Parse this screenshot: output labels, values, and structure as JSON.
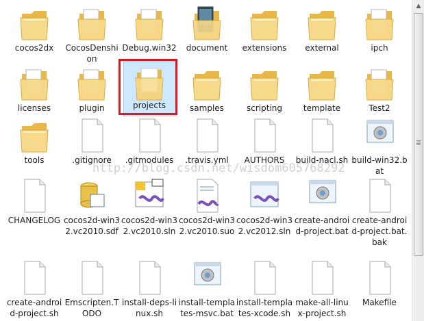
{
  "files": [
    {
      "name": "cocos2dx",
      "type": "folder"
    },
    {
      "name": "CocosDenshion",
      "type": "folder-doc"
    },
    {
      "name": "Debug.win32",
      "type": "folder-doc"
    },
    {
      "name": "document",
      "type": "folder-photo"
    },
    {
      "name": "extensions",
      "type": "folder"
    },
    {
      "name": "external",
      "type": "folder"
    },
    {
      "name": "ipch",
      "type": "folder-doc"
    },
    {
      "name": "licenses",
      "type": "folder-doc"
    },
    {
      "name": "plugin",
      "type": "folder-doc"
    },
    {
      "name": "projects",
      "type": "folder-open",
      "selected": true
    },
    {
      "name": "samples",
      "type": "folder"
    },
    {
      "name": "scripting",
      "type": "folder"
    },
    {
      "name": "template",
      "type": "folder"
    },
    {
      "name": "Test2",
      "type": "folder-doc"
    },
    {
      "name": "tools",
      "type": "folder"
    },
    {
      "name": ".gitignore",
      "type": "file"
    },
    {
      "name": ".gitmodules",
      "type": "file"
    },
    {
      "name": ".travis.yml",
      "type": "file"
    },
    {
      "name": "AUTHORS",
      "type": "file"
    },
    {
      "name": "build-nacl.sh",
      "type": "file"
    },
    {
      "name": "build-win32.bat",
      "type": "bat"
    },
    {
      "name": "CHANGELOG",
      "type": "file"
    },
    {
      "name": "cocos2d-win32.vc2010.sdf",
      "type": "sdf"
    },
    {
      "name": "cocos2d-win32.vc2010.sln",
      "type": "sln10"
    },
    {
      "name": "cocos2d-win32.vc2010.suo",
      "type": "suo"
    },
    {
      "name": "cocos2d-win32.vc2012.sln",
      "type": "sln12"
    },
    {
      "name": "create-android-project.bat",
      "type": "bat"
    },
    {
      "name": "create-android-project.bat.bak",
      "type": "file"
    },
    {
      "name": "create-android-project.sh",
      "type": "file"
    },
    {
      "name": "Emscripten.TODO",
      "type": "file"
    },
    {
      "name": "install-deps-linux.sh",
      "type": "file"
    },
    {
      "name": "install-templates-msvc.bat",
      "type": "bat"
    },
    {
      "name": "install-templates-xcode.sh",
      "type": "file"
    },
    {
      "name": "make-all-linux-project.sh",
      "type": "file"
    },
    {
      "name": "Makefile",
      "type": "file"
    }
  ],
  "watermark": "http://blog.csdn.net/wisdom605768292",
  "colors": {
    "selection": "#cde8ff",
    "highlight_frame": "#e8141c",
    "folder": "#f4d27a"
  }
}
